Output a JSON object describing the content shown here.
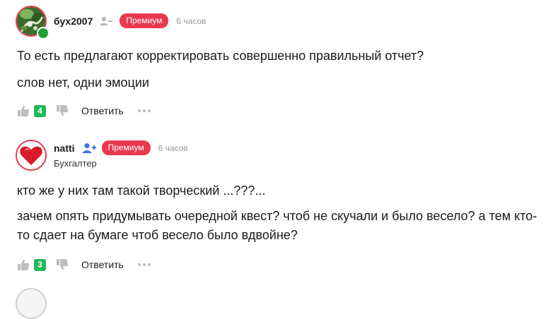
{
  "comments": [
    {
      "username": "бух2007",
      "badge": "Премиум",
      "time": "6 часов",
      "paragraphs": [
        "То есть предлагают корректировать совершенно правильный отчет?",
        "слов нет, одни эмоции"
      ],
      "likes": "4",
      "reply_label": "Ответить",
      "online": true
    },
    {
      "username": "natti",
      "badge": "Премиум",
      "time": "6 часов",
      "role": "Бухгалтер",
      "paragraphs": [
        "кто же у них там такой творческий ...???...",
        "зачем опять придумывать очередной квест? чтоб не скучали и было весело? а тем кто-то сдает на бумаге чтоб весело было вдвойне?"
      ],
      "likes": "3",
      "reply_label": "Ответить"
    }
  ],
  "colors": {
    "premium": "#e8394e",
    "likes_badge": "#21b85a",
    "online": "#21a038",
    "follow_icon": "#3f6ee8"
  }
}
